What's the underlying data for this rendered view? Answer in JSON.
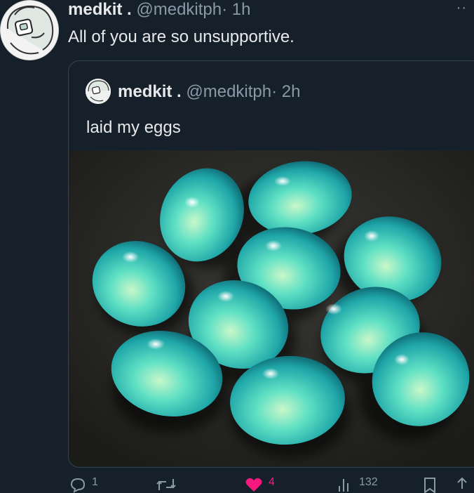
{
  "tweet": {
    "display_name": "medkit .",
    "handle": "@medkitph",
    "time": "· 1h",
    "more_icon": "ellipsis-icon",
    "text": "All of you are so unsupportive."
  },
  "quoted_tweet": {
    "display_name": "medkit .",
    "handle": "@medkitph",
    "time": "· 2h",
    "text": "laid my eggs",
    "image": "glowing-teal-eggs-photo"
  },
  "actions": {
    "reply_count": "1",
    "retweet_count": "",
    "like_count": "4",
    "views_count": "132"
  },
  "colors": {
    "background": "#15202b",
    "text": "#e7e9ea",
    "muted": "#8b98a5",
    "like": "#f91880",
    "border": "#38444d"
  }
}
